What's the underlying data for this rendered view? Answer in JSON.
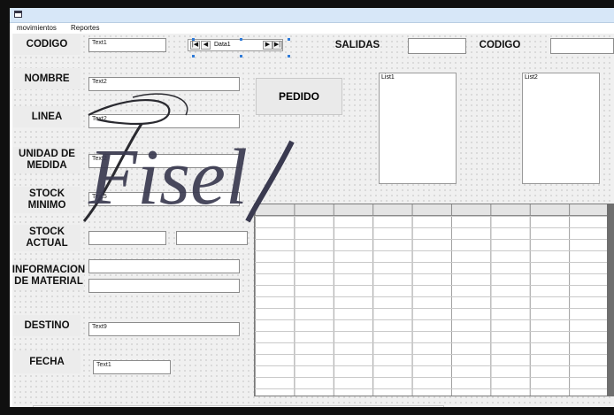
{
  "menu": {
    "items": [
      "movimientos",
      "Reportes"
    ]
  },
  "labels": {
    "codigo": "CODIGO",
    "nombre": "NOMBRE",
    "linea": "LINEA",
    "unidad_medida": "UNIDAD DE MEDIDA",
    "stock_minimo": "STOCK MINIMO",
    "stock_actual": "STOCK ACTUAL",
    "informacion_material": "INFORMACION DE MATERIAL",
    "destino": "DESTINO",
    "fecha": "FECHA",
    "salidas": "SALIDAS",
    "codigo_right": "CODIGO"
  },
  "fields": {
    "codigo": "Text1",
    "nombre": "Text2",
    "linea": "Text2",
    "unidad_medida": "Text2",
    "stock_minimo": "Text5",
    "stock_actual_1": "",
    "stock_actual_2": "",
    "informacion_1": "",
    "informacion_2": "",
    "destino": "Text9",
    "fecha": "Text1",
    "salidas": "",
    "codigo_right": ""
  },
  "data_control": {
    "caption": "Data1",
    "first": "|◀",
    "prev": "◀",
    "next": "▶",
    "last": "▶|"
  },
  "buttons": {
    "pedido": "PEDIDO"
  },
  "lists": {
    "list1": "List1",
    "list2": "List2"
  },
  "watermark": {
    "text": "Fisel"
  }
}
